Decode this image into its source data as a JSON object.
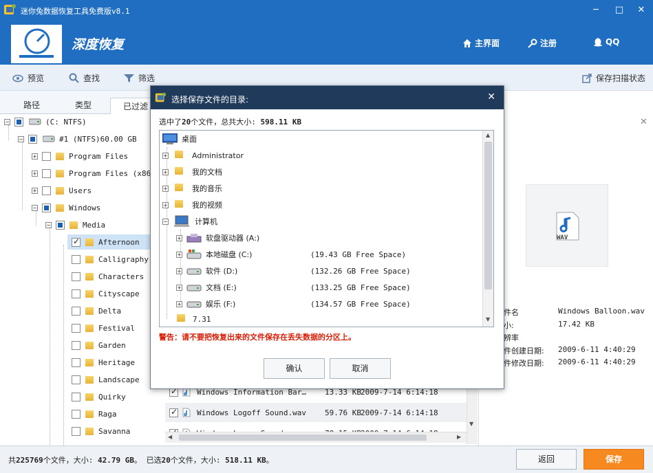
{
  "window": {
    "title": "迷你兔数据恢复工具免费版v8.1",
    "minimize": "─",
    "maximize": "□",
    "close": "✕"
  },
  "header": {
    "brand": "深度恢复",
    "nav": [
      {
        "label": "主界面",
        "icon": "home-icon"
      },
      {
        "label": "注册",
        "icon": "key-icon"
      },
      {
        "label": "QQ",
        "icon": "qq-penguin-icon"
      }
    ]
  },
  "toolbar": {
    "preview": "预览",
    "search": "查找",
    "filter": "筛选",
    "save_scan": "保存扫描状态"
  },
  "tabs": {
    "path": "路径",
    "type": "类型",
    "filtered": "已过滤"
  },
  "tree": {
    "drive": "(C: NTFS)",
    "partition": "#1 (NTFS)60.00 GB",
    "folders": [
      "Program Files",
      "Program Files (x86)",
      "Users",
      "Windows"
    ],
    "media": "Media",
    "media_items": [
      {
        "name": "Afternoon",
        "checked": true
      },
      {
        "name": "Calligraphy",
        "checked": false
      },
      {
        "name": "Characters",
        "checked": false
      },
      {
        "name": "Cityscape",
        "checked": false
      },
      {
        "name": "Delta",
        "checked": false
      },
      {
        "name": "Festival",
        "checked": false
      },
      {
        "name": "Garden",
        "checked": false
      },
      {
        "name": "Heritage",
        "checked": false
      },
      {
        "name": "Landscape",
        "checked": false
      },
      {
        "name": "Quirky",
        "checked": false
      },
      {
        "name": "Raga",
        "checked": false
      },
      {
        "name": "Savanna",
        "checked": false
      }
    ]
  },
  "files": [
    {
      "name": "Windows Information Bar…",
      "size": "13.33 KB",
      "date": "2009-7-14 6:14:18"
    },
    {
      "name": "Windows Logoff Sound.wav",
      "size": "59.76 KB",
      "date": "2009-7-14 6:14:18"
    },
    {
      "name": "Windows Logon Sound…",
      "size": "78.15 KB",
      "date": "2009-7-14 6:14:18"
    }
  ],
  "preview": {
    "badge": "WAV",
    "labels": [
      "件名",
      "小:",
      "辨率",
      "件创建日期:",
      "件修改日期:"
    ],
    "values": [
      "Windows Balloon.wav",
      "17.42 KB",
      "",
      "2009-6-11 4:40:29",
      "2009-6-11 4:40:29"
    ]
  },
  "dialog": {
    "title": "选择保存文件的目录:",
    "info_prefix": "选中了",
    "info_count": "20",
    "info_mid": "个文件，总共大小:",
    "info_size": "598.11 KB",
    "desktop": "桌面",
    "items": [
      {
        "label": "Administrator"
      },
      {
        "label": "我的文档"
      },
      {
        "label": "我的音乐"
      },
      {
        "label": "我的视频"
      },
      {
        "label": "计算机"
      }
    ],
    "drives": [
      {
        "label": "软盘驱动器 (A:)",
        "free": ""
      },
      {
        "label": "本地磁盘 (C:)",
        "free": "(19.43 GB Free Space)"
      },
      {
        "label": "软件 (D:)",
        "free": "(132.26 GB Free Space)"
      },
      {
        "label": "文档 (E:)",
        "free": "(133.25 GB Free Space)"
      },
      {
        "label": "娱乐 (F:)",
        "free": "(134.57 GB Free Space)"
      }
    ],
    "folder_last": "7.31",
    "warning": "警告：请不要把恢复出来的文件保存在丢失数据的分区上。",
    "ok": "确认",
    "cancel": "取消"
  },
  "status": {
    "p1": "共",
    "total_files": "225769",
    "p2": "个文件，大小: ",
    "total_size": "42.79 GB",
    "p3": "。 已选",
    "sel_files": "20",
    "p4": "个文件，大小: ",
    "sel_size": "518.11 KB",
    "p5": "。",
    "back": "返回",
    "save": "保存"
  },
  "colors": {
    "titlebar": "#1f6ec1",
    "dialog_title": "#1f3a5a",
    "save_button": "#f6891f",
    "warning": "#d81e06"
  }
}
